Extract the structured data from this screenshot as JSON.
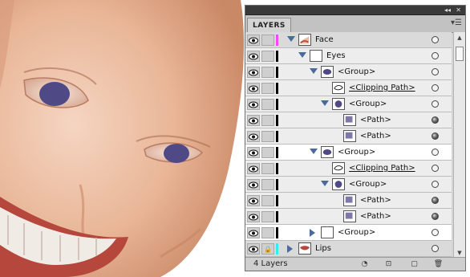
{
  "panel": {
    "tab_label": "LAYERS",
    "footer_count": "4 Layers"
  },
  "rows": [
    {
      "label": "Face",
      "indent": 0,
      "expand": "down",
      "thumb": "face",
      "target": "empty",
      "bar": "#ff44ff"
    },
    {
      "label": "Eyes",
      "indent": 1,
      "expand": "down",
      "thumb": "blank",
      "target": "empty",
      "bar": "#000000",
      "sub": true
    },
    {
      "label": "<Group>",
      "indent": 2,
      "expand": "down",
      "thumb": "eye",
      "target": "empty",
      "bar": "#000000",
      "sub": true
    },
    {
      "label": "<Clipping Path>",
      "indent": 3,
      "expand": "none",
      "thumb": "clip",
      "target": "empty",
      "bar": "#000000",
      "underline": true,
      "sub": true
    },
    {
      "label": "<Group>",
      "indent": 3,
      "expand": "down",
      "thumb": "iris",
      "target": "empty",
      "bar": "#000000",
      "sub": true
    },
    {
      "label": "<Path>",
      "indent": 4,
      "expand": "none",
      "thumb": "swatch",
      "target": "filled",
      "bar": "#000000",
      "sub": true
    },
    {
      "label": "<Path>",
      "indent": 4,
      "expand": "none",
      "thumb": "swatch",
      "target": "filled",
      "bar": "#000000",
      "sub": true
    },
    {
      "label": "<Group>",
      "indent": 2,
      "expand": "down",
      "thumb": "eye",
      "target": "empty",
      "bar": "#000000",
      "white": true
    },
    {
      "label": "<Clipping Path>",
      "indent": 3,
      "expand": "none",
      "thumb": "clip",
      "target": "empty",
      "bar": "#000000",
      "underline": true,
      "sub": true
    },
    {
      "label": "<Group>",
      "indent": 3,
      "expand": "down",
      "thumb": "iris",
      "target": "empty",
      "bar": "#000000",
      "sub": true
    },
    {
      "label": "<Path>",
      "indent": 4,
      "expand": "none",
      "thumb": "swatch",
      "target": "filled",
      "bar": "#000000",
      "sub": true
    },
    {
      "label": "<Path>",
      "indent": 4,
      "expand": "none",
      "thumb": "swatch",
      "target": "filled",
      "bar": "#000000",
      "sub": true
    },
    {
      "label": "<Group>",
      "indent": 2,
      "expand": "right",
      "thumb": "blank",
      "target": "empty",
      "bar": "#000000",
      "white": true
    },
    {
      "label": "Lips",
      "indent": 0,
      "expand": "right",
      "thumb": "lips",
      "target": "empty",
      "bar": "#33eeee",
      "locked": true
    }
  ],
  "colors": {
    "iris": "#4f4a86",
    "skin": "#e9b89b",
    "selection_face": "#ff44ff",
    "selection_lips": "#33eeee"
  },
  "icons": {
    "titlebar": [
      "collapse-icon",
      "close-icon"
    ],
    "footer": [
      "make-clipping-mask-icon",
      "create-sublayer-icon",
      "create-layer-icon",
      "delete-icon"
    ]
  }
}
